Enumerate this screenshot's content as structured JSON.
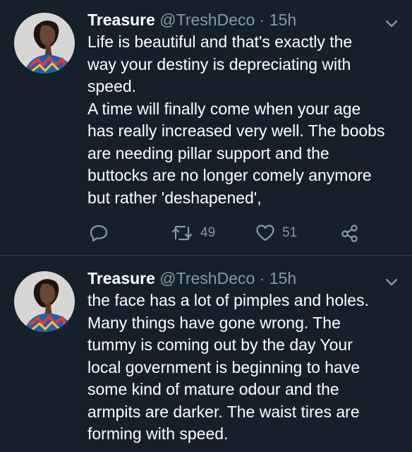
{
  "colors": {
    "background": "#15202b",
    "text": "#ffffff",
    "muted": "#8899a6",
    "divider": "#38444d"
  },
  "tweets": [
    {
      "name": "Treasure",
      "handle": "@TreshDeco",
      "separator": "·",
      "time": "15h",
      "lines": [
        "Life is beautiful and that's exactly the",
        "way your destiny is depreciating with",
        "speed.",
        "A time will finally come when your age",
        "has really increased very well. The boobs",
        "are needing pillar support and the",
        "buttocks are no longer comely anymore",
        "but rather 'deshapened',"
      ],
      "actions": {
        "reply_icon": "reply-icon",
        "retweet_icon": "retweet-icon",
        "retweet_count": "49",
        "like_icon": "heart-icon",
        "like_count": "51",
        "share_icon": "share-icon"
      }
    },
    {
      "name": "Treasure",
      "handle": "@TreshDeco",
      "separator": "·",
      "time": "15h",
      "lines": [
        "the face has a lot of pimples and holes.",
        "Many things have gone wrong. The",
        "tummy is coming out by the day Your",
        "local government is beginning to have",
        "some kind of mature odour and the",
        "armpits are darker. The waist tires are",
        "forming with speed."
      ]
    }
  ]
}
